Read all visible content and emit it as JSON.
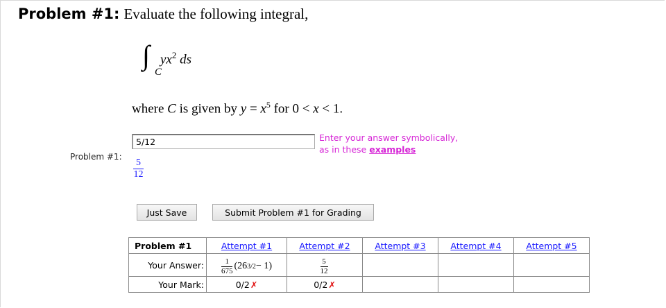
{
  "problem": {
    "heading": "Problem #1:",
    "instruction": "Evaluate the following integral,",
    "integral": {
      "sign": "∫",
      "subscript": "C",
      "integrand_base": "yx",
      "integrand_exp": "2",
      "differential": "ds"
    },
    "where": {
      "prefix": "where ",
      "curve": "C",
      "middle": " is given by ",
      "y": "y",
      "eq": " = ",
      "x": "x",
      "exp": "5",
      "for": " for ",
      "range_start": "0",
      "lt1": " < ",
      "var": "x",
      "lt2": " < ",
      "range_end": "1."
    }
  },
  "answer": {
    "label": "Problem #1:",
    "value": "5/12",
    "preview_num": "5",
    "preview_den": "12",
    "hint_line1": "Enter your answer symbolically,",
    "hint_line2_prefix": "as in these ",
    "hint_link": "examples"
  },
  "buttons": {
    "save": "Just Save",
    "submit": "Submit Problem #1 for Grading"
  },
  "attempts": {
    "title": "Problem #1",
    "headers": [
      "Attempt #1",
      "Attempt #2",
      "Attempt #3",
      "Attempt #4",
      "Attempt #5"
    ],
    "answer_label": "Your Answer:",
    "mark_label": "Your Mark:",
    "attempt1": {
      "frac_num": "1",
      "frac_den": "675",
      "open": "(26",
      "exp": "3/2",
      "rest": " − 1)"
    },
    "attempt2": {
      "frac_num": "5",
      "frac_den": "12"
    },
    "marks": [
      "0/2",
      "0/2"
    ],
    "wrong_symbol": "✗"
  },
  "colors": {
    "hint": "#d626d6",
    "link": "#1a1aff",
    "wrong": "#e01010"
  }
}
